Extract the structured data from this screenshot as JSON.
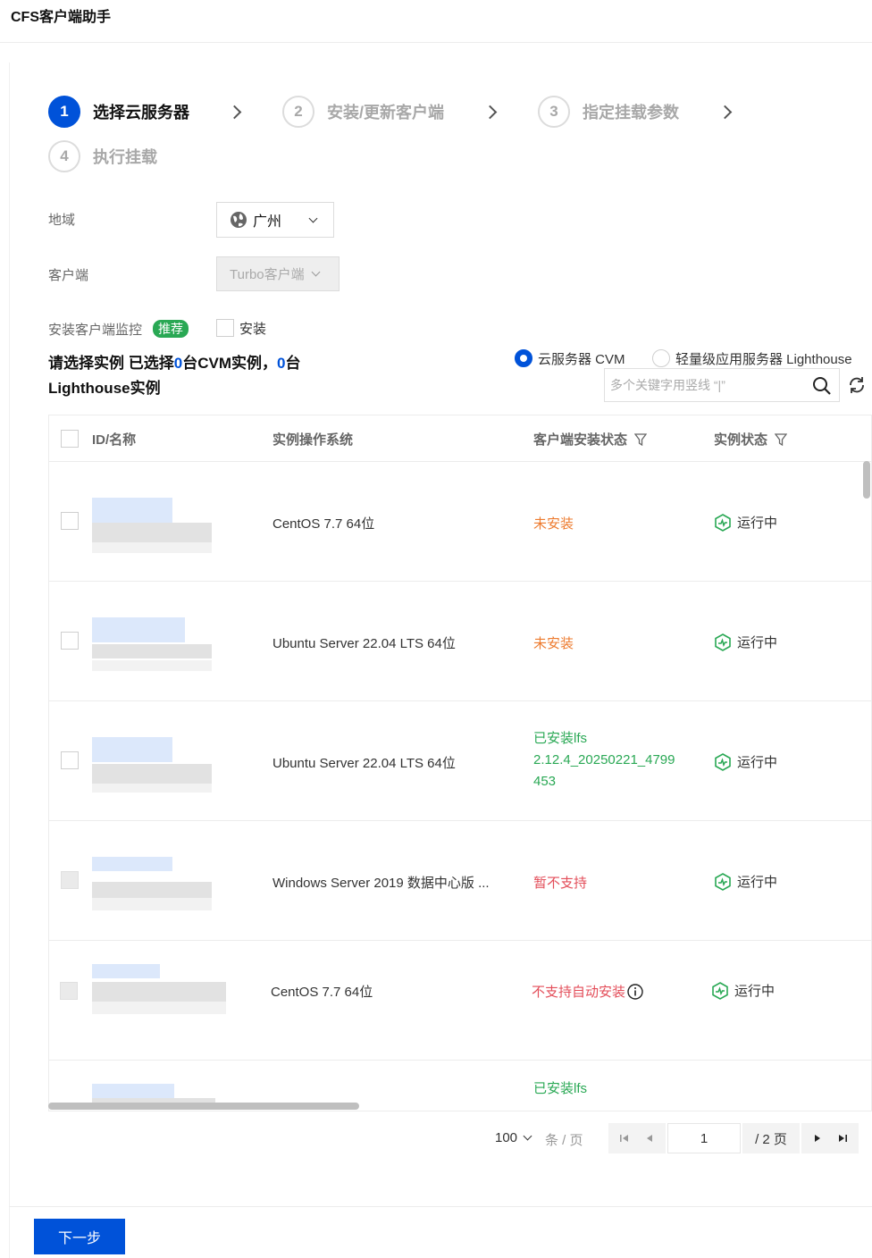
{
  "app": {
    "title": "CFS客户端助手"
  },
  "steps": [
    {
      "num": "1",
      "label": "选择云服务器"
    },
    {
      "num": "2",
      "label": "安装/更新客户端"
    },
    {
      "num": "3",
      "label": "指定挂载参数"
    },
    {
      "num": "4",
      "label": "执行挂载"
    }
  ],
  "form": {
    "region_label": "地域",
    "region_value": "广州",
    "client_label": "客户端",
    "client_value": "Turbo客户端",
    "monitor_label": "安装客户端监控",
    "monitor_badge": "推荐",
    "monitor_checkbox_label": "安装"
  },
  "selection": {
    "prefix": "请选择实例  已选择",
    "cvm_count": "0",
    "mid": "台CVM实例，",
    "lh_count": "0",
    "suffix_line1": "台",
    "line2": "Lighthouse实例"
  },
  "instance_type": {
    "options": [
      "云服务器 CVM",
      "轻量级应用服务器 Lighthouse"
    ],
    "selected": "云服务器 CVM"
  },
  "search": {
    "placeholder": "多个关键字用竖线 “|”"
  },
  "table": {
    "columns": [
      "ID/名称",
      "实例操作系统",
      "客户端安装状态",
      "实例状态"
    ],
    "rows": [
      {
        "os": "CentOS 7.7 64位",
        "install_status": "未安装",
        "status": "运行中"
      },
      {
        "os": "Ubuntu Server 22.04 LTS 64位",
        "install_status": "未安装",
        "status": "运行中"
      },
      {
        "os": "Ubuntu Server 22.04 LTS 64位",
        "install_status_lines": [
          "已安装lfs",
          "2.12.4_20250221_4799",
          "453"
        ],
        "status": "运行中"
      },
      {
        "os": "Windows Server 2019 数据中心版 ...",
        "install_status": "暂不支持",
        "status": "运行中"
      },
      {
        "os": "CentOS 7.7 64位",
        "install_status": "不支持自动安装",
        "status": "运行中"
      },
      {
        "install_status": "已安装lfs"
      }
    ]
  },
  "pagination": {
    "page_size": "100",
    "unit": "条 / 页",
    "current": "1",
    "total": "/ 2 页"
  },
  "footer": {
    "next_label": "下一步"
  },
  "colors": {
    "primary": "#0052d9",
    "success": "#29a854",
    "warning": "#ed7b2f",
    "error": "#e34d59"
  }
}
